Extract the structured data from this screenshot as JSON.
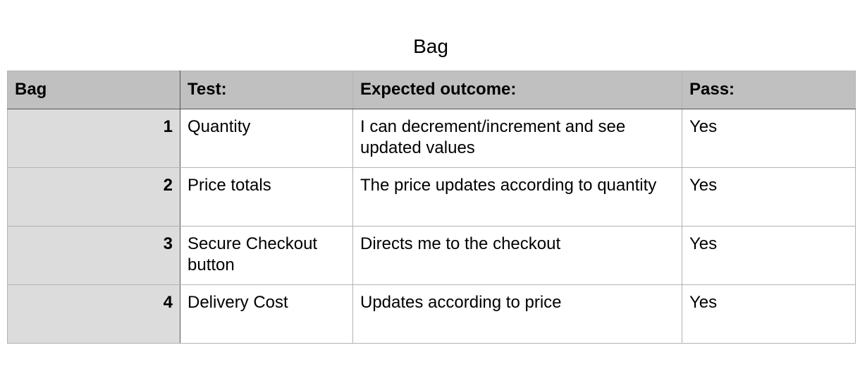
{
  "title": "Bag",
  "table": {
    "headers": [
      "Bag",
      "Test:",
      "Expected outcome:",
      "Pass:"
    ],
    "rows": [
      {
        "num": "1",
        "test": "Quantity",
        "expected": "I can decrement/increment and see updated values",
        "pass": "Yes"
      },
      {
        "num": "2",
        "test": "Price totals",
        "expected": "The price updates according to quantity",
        "pass": "Yes"
      },
      {
        "num": "3",
        "test": "Secure Checkout button",
        "expected": "Directs me to the checkout",
        "pass": "Yes"
      },
      {
        "num": "4",
        "test": "Delivery Cost",
        "expected": "Updates according to price",
        "pass": "Yes"
      }
    ]
  },
  "colors": {
    "header_bg": "#bfc0bf",
    "row_header_bg": "#dcdcdc",
    "grid_line": "#b3b3b3"
  }
}
